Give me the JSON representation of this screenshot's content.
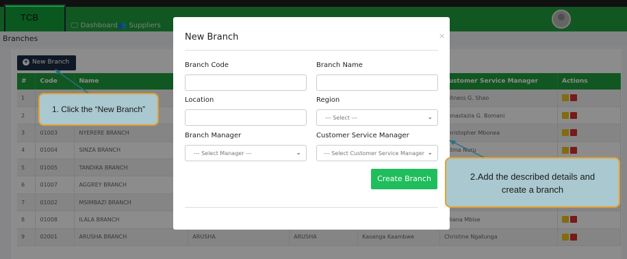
{
  "app": {
    "brand": "TCB"
  },
  "nav": {
    "items": [
      {
        "label": "Dashboard",
        "icon": "monitor-icon",
        "glyph": "🖵"
      },
      {
        "label": "Suppliers",
        "icon": "users-icon",
        "glyph": "👥"
      }
    ]
  },
  "page": {
    "title": "Branches",
    "new_button": "New Branch"
  },
  "table": {
    "headers": [
      "#",
      "Code",
      "Name",
      "",
      "",
      "",
      "Customer Service Manager",
      "Actions"
    ],
    "rows": [
      {
        "num": "1",
        "code": "",
        "name": "",
        "c4": "",
        "c5": "",
        "c6": "",
        "csm": "Witness G. Shao"
      },
      {
        "num": "2",
        "code": "",
        "name": "",
        "c4": "",
        "c5": "",
        "c6": "",
        "csm": "Annastazia G. Bomani"
      },
      {
        "num": "3",
        "code": "01003",
        "name": "NYERERE BRANCH",
        "c4": "",
        "c5": "",
        "c6": "",
        "csm": "Christopher Mbonea"
      },
      {
        "num": "4",
        "code": "01004",
        "name": "SINZA BRANCH",
        "c4": "",
        "c5": "",
        "c6": "",
        "csm": "Fatma Nuru"
      },
      {
        "num": "5",
        "code": "01005",
        "name": "TANDIKA BRANCH",
        "c4": "",
        "c5": "",
        "c6": "",
        "csm": ""
      },
      {
        "num": "6",
        "code": "01007",
        "name": "AGGREY BRANCH",
        "c4": "",
        "c5": "",
        "c6": "",
        "csm": ""
      },
      {
        "num": "7",
        "code": "01002",
        "name": "MSIMBAZI BRANCH",
        "c4": "",
        "c5": "",
        "c6": "",
        "csm": ""
      },
      {
        "num": "8",
        "code": "01008",
        "name": "ILALA BRANCH",
        "c4": "",
        "c5": "",
        "c6": "",
        "csm": "Juliana Mbise"
      },
      {
        "num": "9",
        "code": "02001",
        "name": "ARUSHA BRANCH",
        "c4": "ARUSHA",
        "c5": "ARUSHA",
        "c6": "Kasanga Kaambwe",
        "csm": "Christine Ngatunga"
      }
    ]
  },
  "modal": {
    "title": "New Branch",
    "close": "×",
    "branch_code": {
      "label": "Branch Code",
      "value": ""
    },
    "branch_name": {
      "label": "Branch Name",
      "value": ""
    },
    "location": {
      "label": "Location",
      "value": ""
    },
    "region": {
      "label": "Region",
      "selected": "--- Select ---"
    },
    "branch_manager": {
      "label": "Branch Manager",
      "selected": "--- Select Manager ---"
    },
    "csm": {
      "label": "Customer Service Manager",
      "selected": "--- Select Customer Service Manager ---"
    },
    "submit": "Create Branch"
  },
  "callouts": {
    "step1": "1. Click the “New Branch”",
    "step2_line1": "2.Add the described details and",
    "step2_line2": "create a branch"
  },
  "colors": {
    "brand_green": "#1f9e3c",
    "button_green": "#1fbd5b",
    "navy": "#1d2d44",
    "callout_border": "#e7a02d",
    "callout_fill": "#a9c8cf"
  }
}
